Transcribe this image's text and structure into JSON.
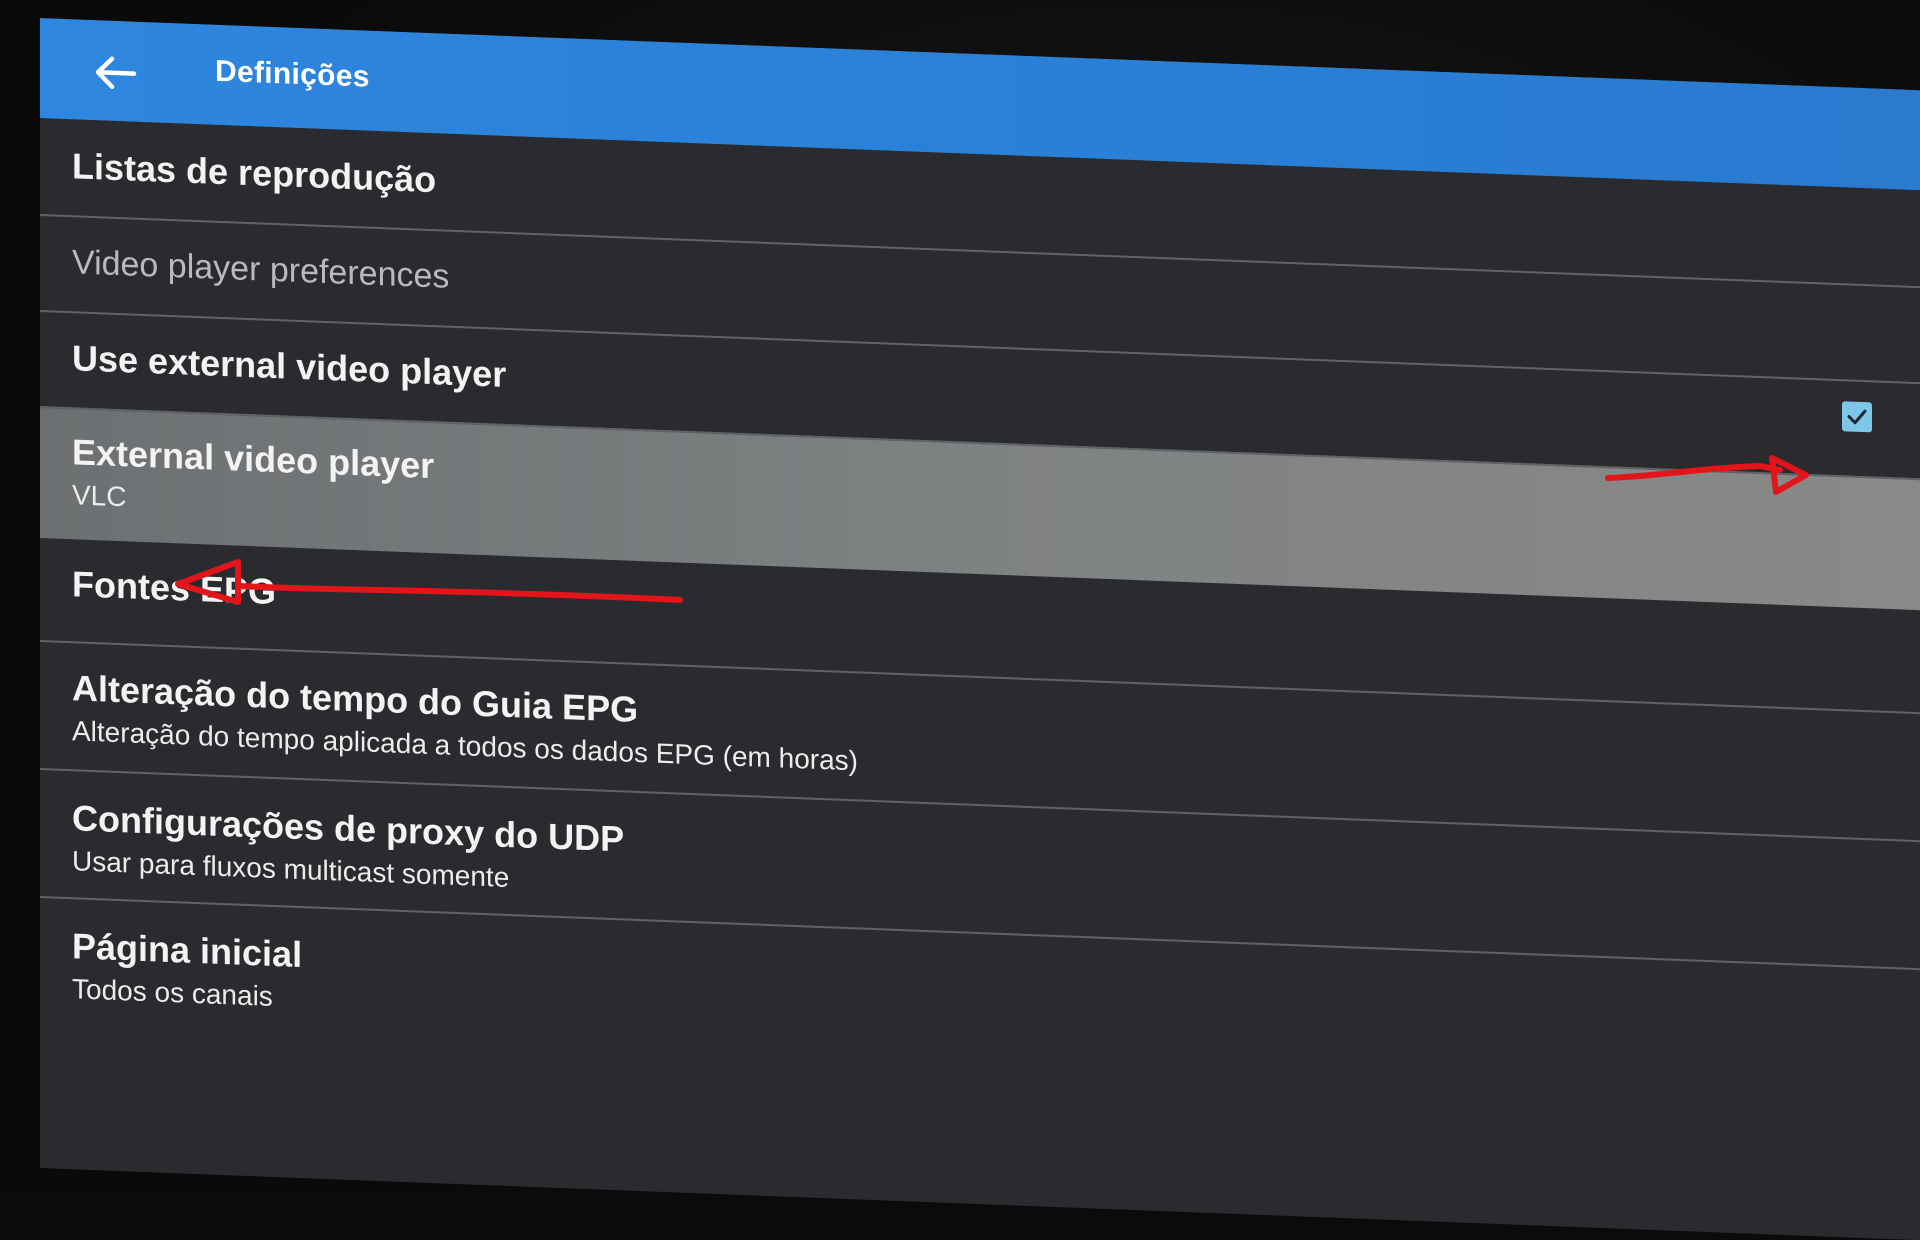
{
  "appbar": {
    "title": "Definições",
    "back_icon": "arrow-back-icon"
  },
  "settings": {
    "playlists": {
      "title": "Listas de reprodução"
    },
    "video_player_header": {
      "title": "Video player preferences"
    },
    "use_external_player": {
      "title": "Use external video player",
      "checked": true
    },
    "external_player": {
      "title": "External video player",
      "subtitle": "VLC"
    },
    "epg_sources": {
      "title": "Fontes EPG"
    },
    "epg_time_shift": {
      "title": "Alteração do tempo do Guia EPG",
      "subtitle": "Alteração do tempo aplicada a todos os dados EPG (em horas)"
    },
    "udp_proxy": {
      "title": "Configurações de proxy do UDP",
      "subtitle": "Usar para fluxos multicast somente"
    },
    "home_page": {
      "title": "Página inicial",
      "subtitle": "Todos os canais"
    }
  },
  "colors": {
    "appbar": "#2f86de",
    "background": "#2a2b2e",
    "selected_row": "#7f8283",
    "checkbox": "#7ec7e8",
    "annotation": "#e4141b"
  }
}
